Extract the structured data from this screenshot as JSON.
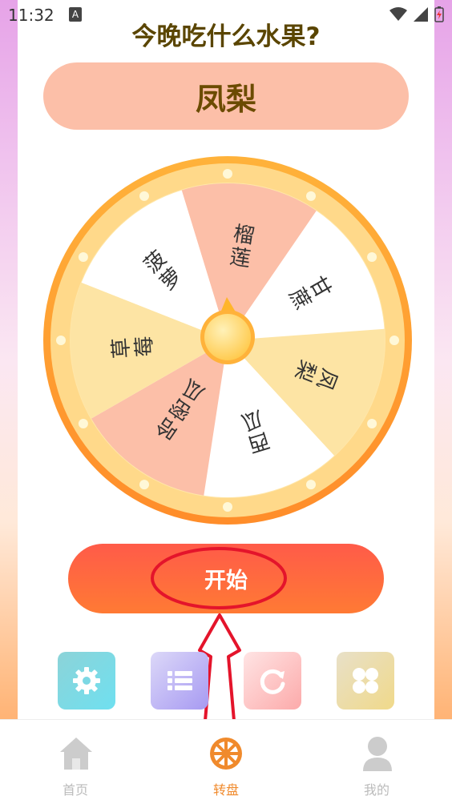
{
  "status_bar": {
    "time": "11:32",
    "notification_letter": "A"
  },
  "header": {
    "title": "今晚吃什么水果?"
  },
  "result": {
    "text": "凤梨"
  },
  "wheel": {
    "segments": [
      {
        "label": "榴莲",
        "color": "#fcbfa8"
      },
      {
        "label": "甘蔗",
        "color": "#ffffff"
      },
      {
        "label": "凤梨",
        "color": "#fde4a4"
      },
      {
        "label": "西瓜",
        "color": "#ffffff"
      },
      {
        "label": "哈密瓜",
        "color": "#fcbfa8"
      },
      {
        "label": "草莓",
        "color": "#fde4a4"
      },
      {
        "label": "菠萝",
        "color": "#ffffff"
      }
    ]
  },
  "actions": {
    "start_label": "开始"
  },
  "tools": [
    {
      "name": "settings-icon"
    },
    {
      "name": "list-icon"
    },
    {
      "name": "refresh-icon"
    },
    {
      "name": "grid-icon"
    }
  ],
  "tabbar": {
    "items": [
      {
        "label": "首页",
        "icon": "home-icon",
        "active": false
      },
      {
        "label": "转盘",
        "icon": "wheel-icon",
        "active": true
      },
      {
        "label": "我的",
        "icon": "user-icon",
        "active": false
      }
    ]
  },
  "colors": {
    "accent": "#ff7a34",
    "title": "#5a4500",
    "active_tab": "#f08a2c",
    "inactive_tab": "#bbbbbb"
  }
}
